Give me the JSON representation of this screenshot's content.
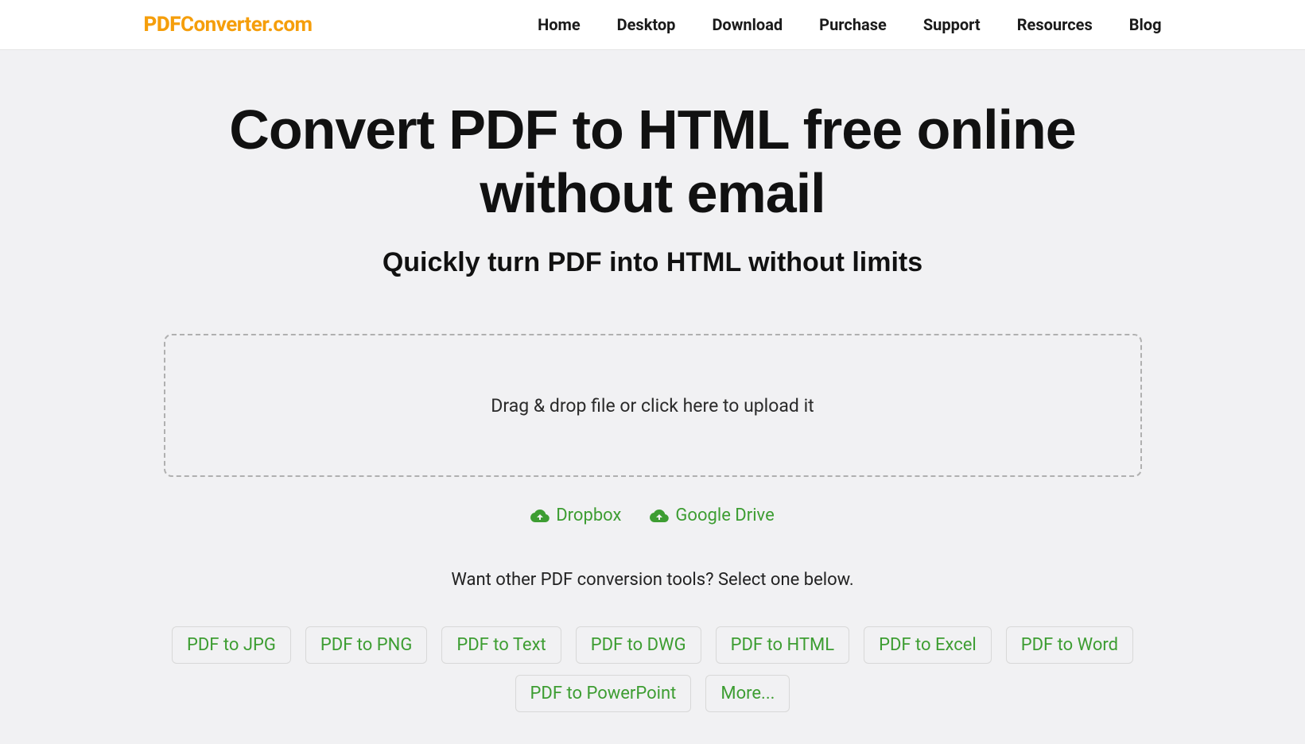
{
  "header": {
    "logo_bold": "PDF",
    "logo_rest": "Converter.com",
    "nav": [
      "Home",
      "Desktop",
      "Download",
      "Purchase",
      "Support",
      "Resources",
      "Blog"
    ]
  },
  "main": {
    "title": "Convert PDF to HTML free online without email",
    "subtitle": "Quickly turn PDF into HTML without limits",
    "dropzone_text": "Drag & drop file or click here to upload it",
    "cloud": {
      "dropbox": "Dropbox",
      "google_drive": "Google Drive"
    },
    "tools_prompt": "Want other PDF conversion tools? Select one below.",
    "tools": [
      "PDF to JPG",
      "PDF to PNG",
      "PDF to Text",
      "PDF to DWG",
      "PDF to HTML",
      "PDF to Excel",
      "PDF to Word",
      "PDF to PowerPoint",
      "More..."
    ]
  }
}
